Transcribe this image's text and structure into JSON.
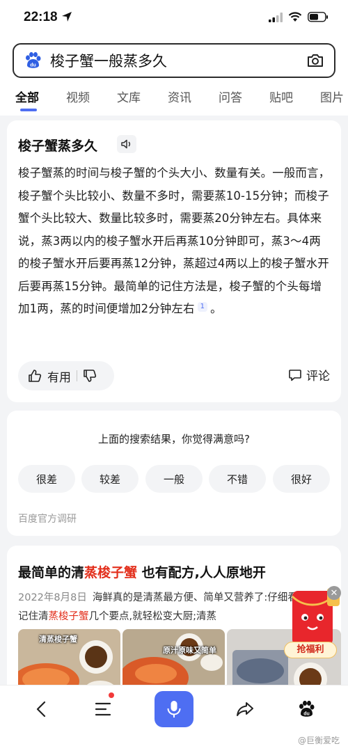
{
  "status_bar": {
    "time": "22:18"
  },
  "search": {
    "query": "梭子蟹一般蒸多久"
  },
  "tabs": [
    "全部",
    "视频",
    "文库",
    "资讯",
    "问答",
    "贴吧",
    "图片"
  ],
  "answer": {
    "title": "梭子蟹蒸多久",
    "body": "梭子蟹蒸的时间与梭子蟹的个头大小、数量有关。一般而言，梭子蟹个头比较小、数量不多时，需要蒸10-15分钟；而梭子蟹个头比较大、数量比较多时，需要蒸20分钟左右。具体来说，蒸3两以内的梭子蟹水开后再蒸10分钟即可，蒸3～4两的梭子蟹水开后要再蒸12分钟，蒸超过4两以上的梭子蟹水开后要再蒸15分钟。最简单的记住方法是，梭子蟹的个头每增加1两，蒸的时间便增加2分钟左右",
    "citation": "1",
    "end_punct": "。",
    "useful_label": "有用",
    "comment_label": "评论"
  },
  "survey": {
    "question": "上面的搜索结果，你觉得满意吗?",
    "options": [
      "很差",
      "较差",
      "一般",
      "不错",
      "很好"
    ],
    "source": "百度官方调研"
  },
  "result": {
    "title_pre": "最简单的清",
    "title_hl": "蒸梭子蟹",
    "title_post": " 也有配方,人人原地开",
    "date": "2022年8月8日",
    "snippet_pre": "海鲜真的是清蒸最方便、简单又营养了:仔细看这几点 记住清",
    "snippet_hl": "蒸梭子蟹",
    "snippet_post": "几个要点,就轻松变大厨;清蒸",
    "thumb_labels": [
      "清蒸梭子蟹",
      "原汁原味又简单"
    ]
  },
  "promo": {
    "label": "抢福利"
  },
  "watermark": "@巨衡爱吃",
  "colors": {
    "accent": "#4e6ef2",
    "highlight": "#e3301d"
  }
}
